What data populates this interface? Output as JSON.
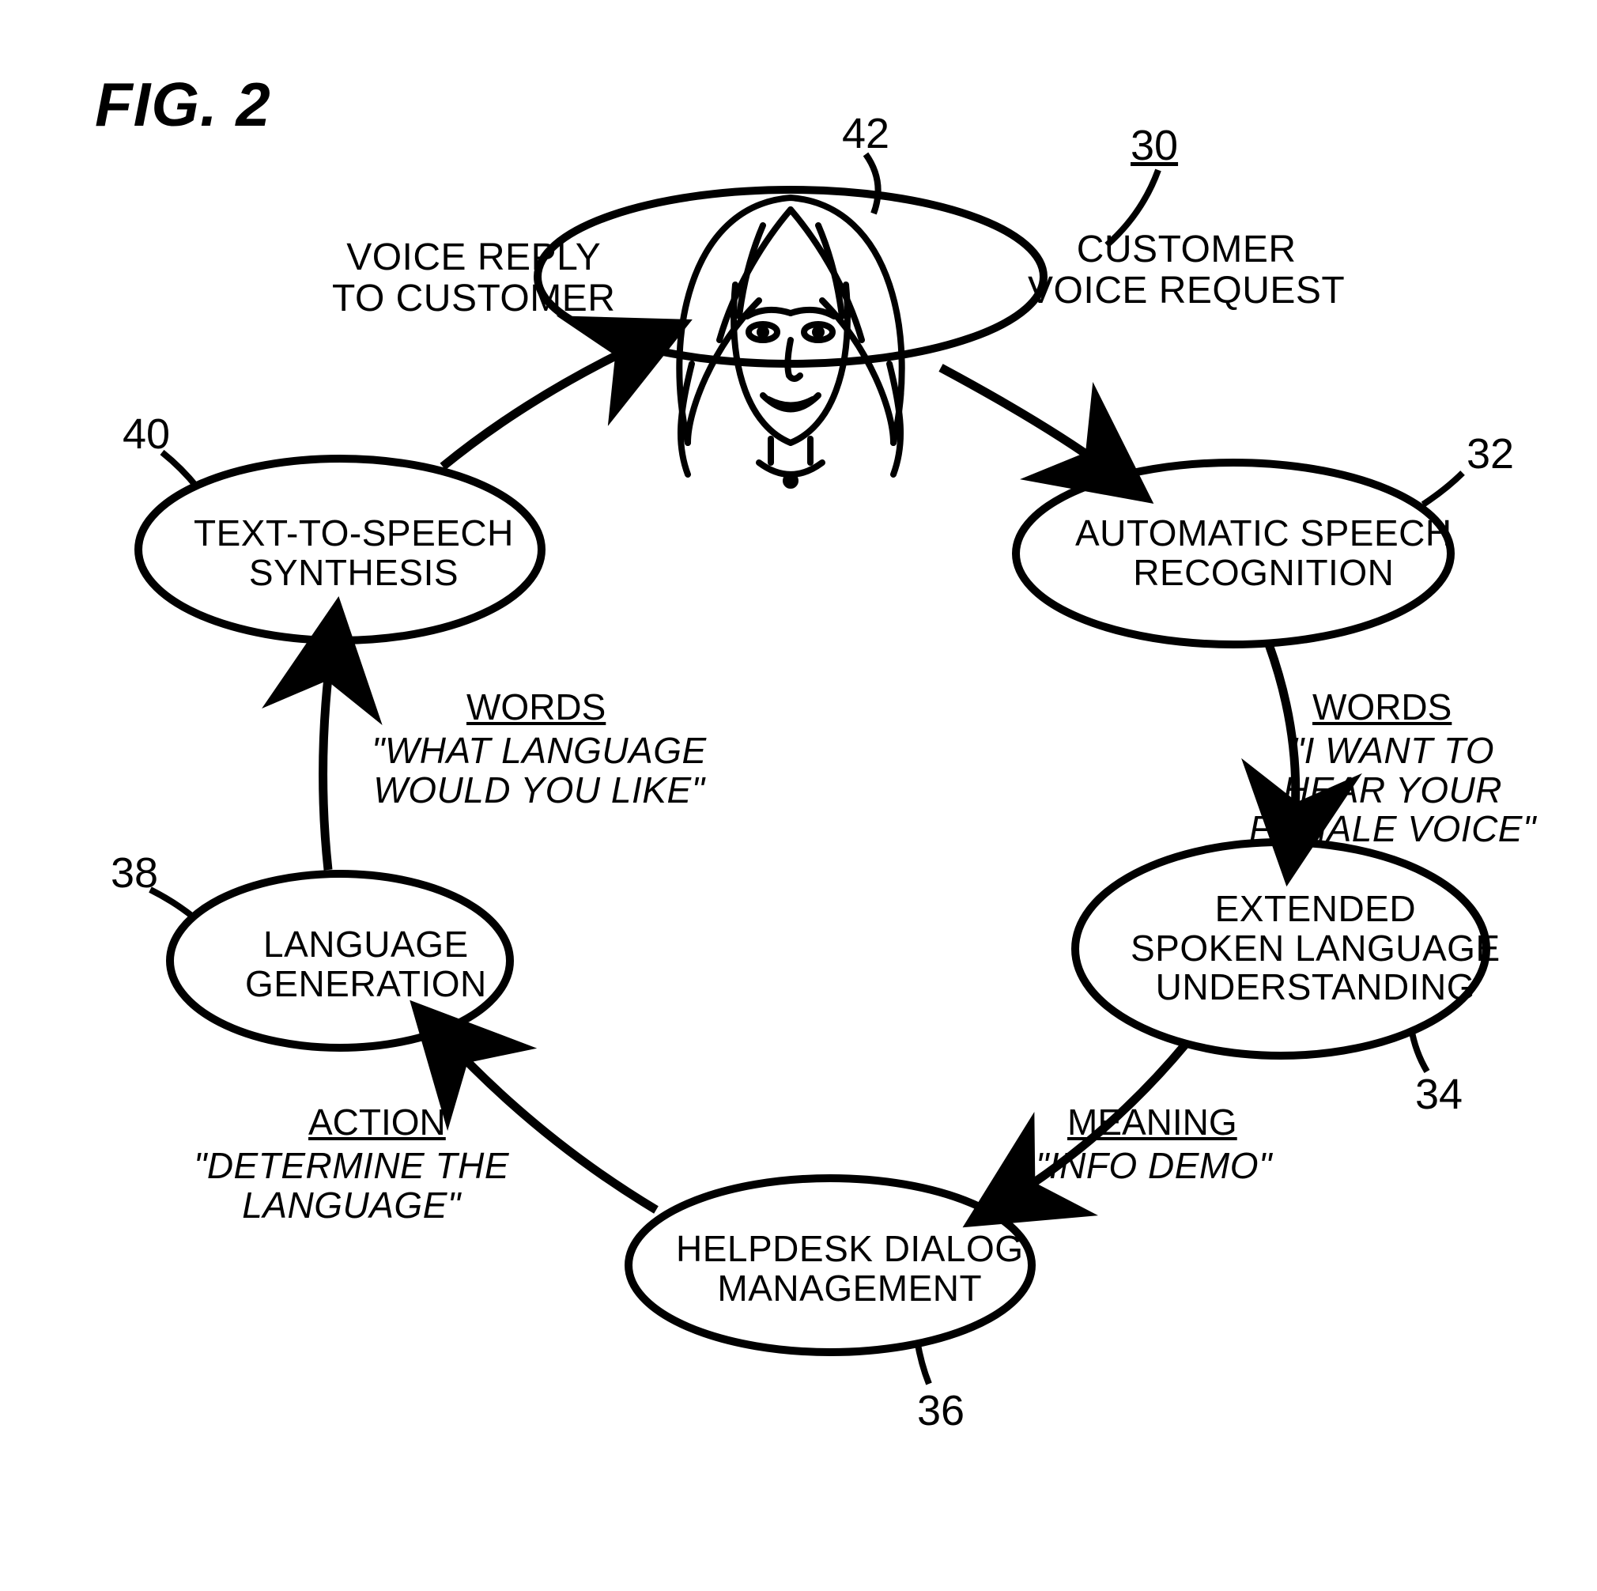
{
  "figure_label": "FIG. 2",
  "figure_ref": "30",
  "refs": {
    "customer": "42",
    "asr": "32",
    "slu": "34",
    "dm": "36",
    "lg": "38",
    "tts": "40"
  },
  "arcs": {
    "to_customer_reply": "VOICE REPLY\nTO CUSTOMER",
    "from_customer_req": "CUSTOMER\nVOICE REQUEST",
    "words_right_head": "WORDS",
    "words_right_body": "\"I WANT TO\nHEAR YOUR\nFEMALE VOICE\"",
    "meaning_head": "MEANING",
    "meaning_body": "\"INFO DEMO\"",
    "action_head": "ACTION",
    "action_body": "\"DETERMINE THE\nLANGUAGE\"",
    "words_left_head": "WORDS",
    "words_left_body": "\"WHAT LANGUAGE\nWOULD YOU LIKE\""
  },
  "nodes": {
    "asr": "AUTOMATIC SPEECH\nRECOGNITION",
    "slu": "EXTENDED\nSPOKEN LANGUAGE\nUNDERSTANDING",
    "dm": "HELPDESK DIALOG\nMANAGEMENT",
    "lg": "LANGUAGE\nGENERATION",
    "tts": "TEXT-TO-SPEECH\nSYNTHESIS"
  }
}
